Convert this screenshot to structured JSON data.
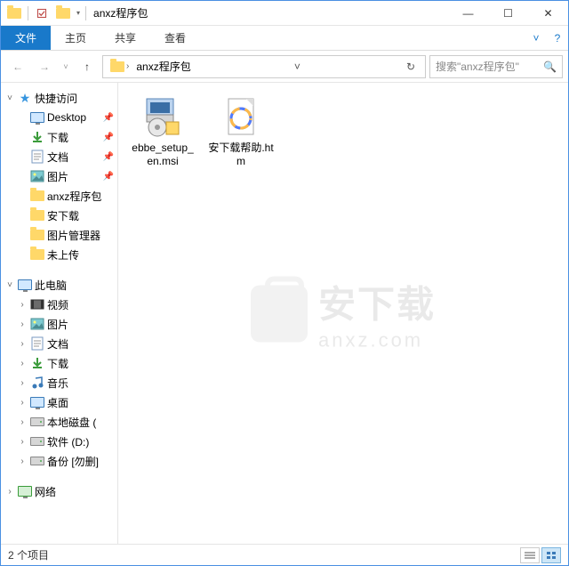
{
  "title": "anxz程序包",
  "qat": {
    "dropdown": "▾"
  },
  "window_controls": {
    "min": "—",
    "max": "☐",
    "close": "✕"
  },
  "ribbon": {
    "file": "文件",
    "tabs": [
      "主页",
      "共享",
      "查看"
    ],
    "expand": "˅",
    "help": "?"
  },
  "nav": {
    "back": "←",
    "forward": "→",
    "recent": "˅",
    "up": "↑",
    "breadcrumb": [
      "anxz程序包"
    ],
    "refresh": "↻",
    "search_placeholder": "搜索\"anxz程序包\"",
    "search_icon": "🔍"
  },
  "sidebar": {
    "quick_access": "快捷访问",
    "quick_items": [
      {
        "label": "Desktop",
        "icon": "desktop",
        "pin": true
      },
      {
        "label": "下载",
        "icon": "download",
        "pin": true
      },
      {
        "label": "文档",
        "icon": "doc",
        "pin": true
      },
      {
        "label": "图片",
        "icon": "pic",
        "pin": true
      },
      {
        "label": "anxz程序包",
        "icon": "folder",
        "pin": false
      },
      {
        "label": "安下载",
        "icon": "folder",
        "pin": false
      },
      {
        "label": "图片管理器",
        "icon": "folder",
        "pin": false
      },
      {
        "label": "未上传",
        "icon": "folder",
        "pin": false
      }
    ],
    "this_pc": "此电脑",
    "pc_items": [
      {
        "label": "视频",
        "icon": "video"
      },
      {
        "label": "图片",
        "icon": "pic"
      },
      {
        "label": "文档",
        "icon": "doc"
      },
      {
        "label": "下载",
        "icon": "download"
      },
      {
        "label": "音乐",
        "icon": "music"
      },
      {
        "label": "桌面",
        "icon": "desktop"
      },
      {
        "label": "本地磁盘 (",
        "icon": "drive"
      },
      {
        "label": "软件 (D:)",
        "icon": "drive"
      },
      {
        "label": "备份 [勿删]",
        "icon": "drive"
      }
    ],
    "network": "网络"
  },
  "files": [
    {
      "name": "ebbe_setup_en.msi",
      "type": "msi"
    },
    {
      "name": "安下载帮助.htm",
      "type": "htm"
    }
  ],
  "watermark": {
    "text": "安下载",
    "sub": "anxz.com"
  },
  "status": {
    "count_label": "2 个项目"
  }
}
